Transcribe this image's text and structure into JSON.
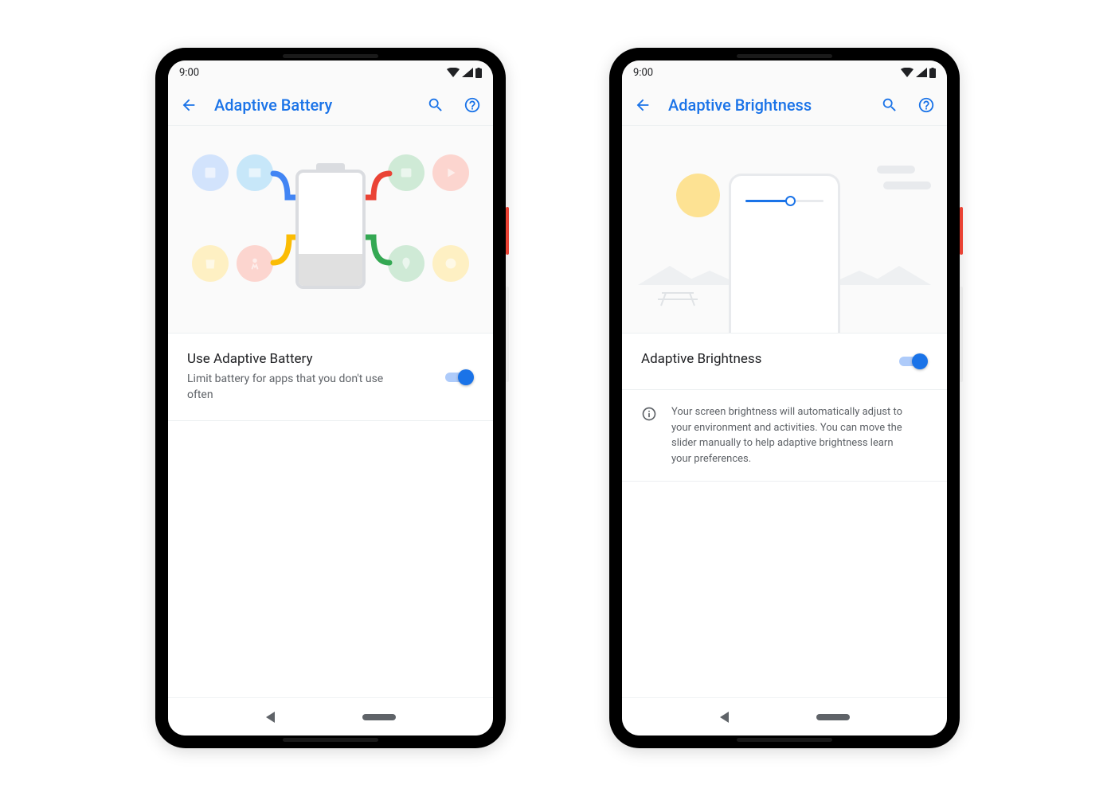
{
  "statusbar": {
    "time": "9:00"
  },
  "phones": {
    "left": {
      "appbar": {
        "title": "Adaptive Battery"
      },
      "setting": {
        "title": "Use Adaptive Battery",
        "subtitle": "Limit battery for apps that you don't use often",
        "toggle_on": true
      }
    },
    "right": {
      "appbar": {
        "title": "Adaptive Brightness"
      },
      "setting": {
        "title": "Adaptive Brightness",
        "toggle_on": true
      },
      "info": {
        "text": "Your screen brightness will automatically adjust to your environment and activities. You can move the slider manually to help adaptive brightness learn your preferences."
      }
    }
  },
  "colors": {
    "accent": "#1a73e8",
    "google_red": "#ea4335",
    "google_yellow": "#fbbc04",
    "google_green": "#34a853",
    "google_blue": "#4285f4"
  }
}
